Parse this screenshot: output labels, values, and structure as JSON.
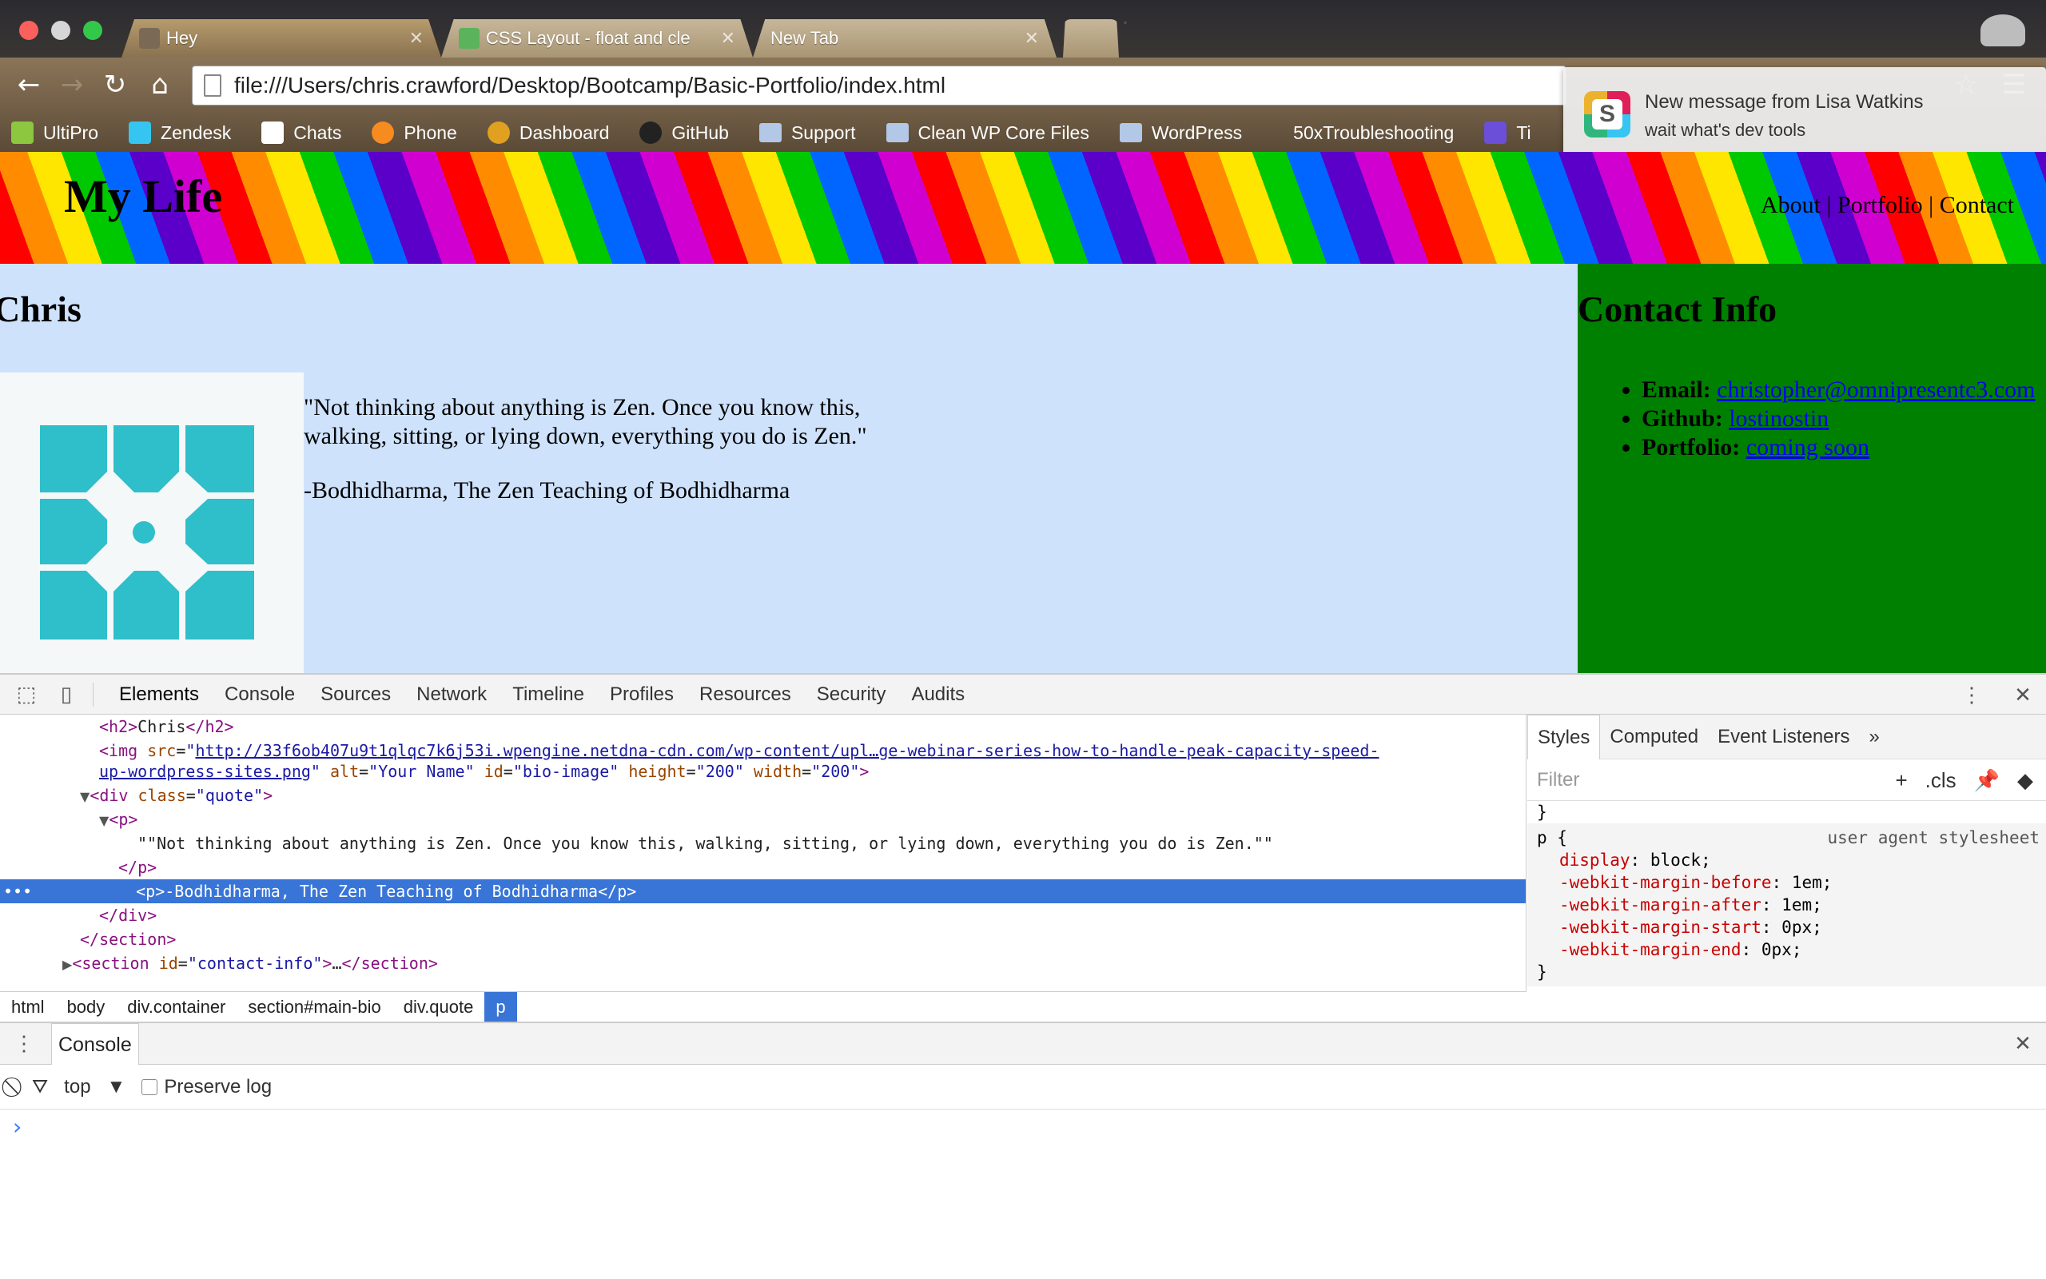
{
  "browser": {
    "tabs": [
      {
        "title": "Hey",
        "active": true
      },
      {
        "title": "CSS Layout - float and cle",
        "active": false
      },
      {
        "title": "New Tab",
        "active": false
      }
    ],
    "url": "file:///Users/chris.crawford/Desktop/Bootcamp/Basic-Portfolio/index.html",
    "bookmarks": [
      "UltiPro",
      "Zendesk",
      "Chats",
      "Phone",
      "Dashboard",
      "GitHub",
      "Support",
      "Clean WP Core Files",
      "WordPress",
      "50xTroubleshooting",
      "Ti"
    ]
  },
  "notification": {
    "title": "New message from Lisa Watkins",
    "body": "wait what's dev tools"
  },
  "site": {
    "title": "My Life",
    "nav": {
      "about": "About",
      "portfolio": "Portfolio",
      "contact": "Contact",
      "sep": " | "
    },
    "bio": {
      "heading": "Chris",
      "quote": "\"Not thinking about anything is Zen. Once you know this, walking, sitting, or lying down, everything you do is Zen.\"",
      "attribution": "-Bodhidharma, The Zen Teaching of Bodhidharma"
    },
    "contact": {
      "heading": "Contact Info",
      "items": [
        {
          "label": "Email:",
          "value": "christopher@omnipresentc3.com"
        },
        {
          "label": "Github:",
          "value": "lostinostin"
        },
        {
          "label": "Portfolio:",
          "value": "coming soon"
        }
      ]
    }
  },
  "devtools": {
    "tabs": [
      "Elements",
      "Console",
      "Sources",
      "Network",
      "Timeline",
      "Profiles",
      "Resources",
      "Security",
      "Audits"
    ],
    "dom": {
      "h2_open": "<h2>",
      "h2_text": "Chris",
      "h2_close": "</h2>",
      "img_src": "http://33f6ob407u9t1qlqc7k6j53i.wpengine.netdna-cdn.com/wp-content/upl…ge-webinar-series-how-to-handle-peak-capacity-speed-",
      "img_src2": "up-wordpress-sites.png",
      "img_alt": "Your Name",
      "img_id": "bio-image",
      "img_height": "200",
      "img_width": "200",
      "div_class": "quote",
      "p1_text": "\"\"Not thinking about anything is Zen. Once you know this, walking, sitting, or lying down, everything you do is Zen.\"\"",
      "p2_text": "-Bodhidharma, The Zen Teaching of Bodhidharma",
      "section_id": "contact-info"
    },
    "breadcrumbs": [
      "html",
      "body",
      "div.container",
      "section#main-bio",
      "div.quote",
      "p"
    ],
    "styles_tabs": [
      "Styles",
      "Computed",
      "Event Listeners"
    ],
    "filter_placeholder": "Filter",
    "cls_label": ".cls",
    "rule": {
      "selector": "p {",
      "source": "user agent stylesheet",
      "props": [
        {
          "name": "display",
          "value": "block;"
        },
        {
          "name": "-webkit-margin-before",
          "value": "1em;"
        },
        {
          "name": "-webkit-margin-after",
          "value": "1em;"
        },
        {
          "name": "-webkit-margin-start",
          "value": "0px;"
        },
        {
          "name": "-webkit-margin-end",
          "value": "0px;"
        }
      ]
    },
    "console": {
      "tab": "Console",
      "context": "top",
      "preserve_log": "Preserve log",
      "prompt": "›"
    }
  },
  "colors": {
    "bio_bg": "#cfe2fb",
    "contact_bg": "#008000",
    "selection": "#3875d7",
    "icon_teal": "#2fbfca"
  }
}
